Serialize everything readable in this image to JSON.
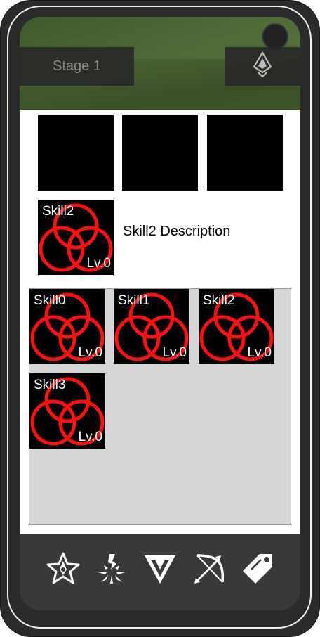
{
  "header": {
    "stage_label": "Stage 1",
    "rank_icon": "rank-emblem-icon"
  },
  "equipped_slots": [
    {
      "state": "empty"
    },
    {
      "state": "empty"
    },
    {
      "state": "empty"
    }
  ],
  "selected_skill": {
    "name": "Skill2",
    "level": "Lv.0",
    "description": "Skill2 Description"
  },
  "inventory": {
    "skills": [
      {
        "name": "Skill0",
        "level": "Lv.0"
      },
      {
        "name": "Skill1",
        "level": "Lv.0"
      },
      {
        "name": "Skill2",
        "level": "Lv.0"
      },
      {
        "name": "Skill3",
        "level": "Lv.0"
      }
    ]
  },
  "bottom_nav": [
    {
      "icon": "star-emblem-icon"
    },
    {
      "icon": "skill-burst-icon"
    },
    {
      "icon": "chevron-triangle-icon"
    },
    {
      "icon": "bow-arrow-icon"
    },
    {
      "icon": "tag-icon"
    }
  ],
  "colors": {
    "skill_ring": "#ff1010",
    "inventory_bg": "#d6d6d6",
    "bar_bg": "#3a3a3a"
  }
}
